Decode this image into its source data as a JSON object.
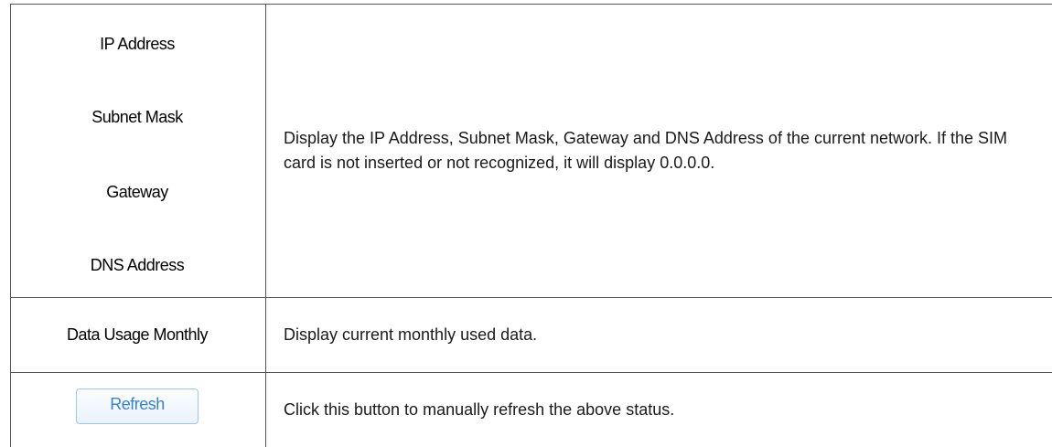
{
  "rows": {
    "ip_address": "IP Address",
    "subnet_mask": "Subnet Mask",
    "gateway": "Gateway",
    "dns_address": "DNS Address",
    "network_description": "Display the IP Address, Subnet Mask, Gateway and DNS Address of the current network. If the SIM card is not inserted or not recognized, it will display 0.0.0.0.",
    "data_usage_monthly": "Data Usage Monthly",
    "data_usage_description": "Display current monthly used data.",
    "refresh_button": "Refresh",
    "refresh_description": "Click this button to manually refresh the above status."
  }
}
